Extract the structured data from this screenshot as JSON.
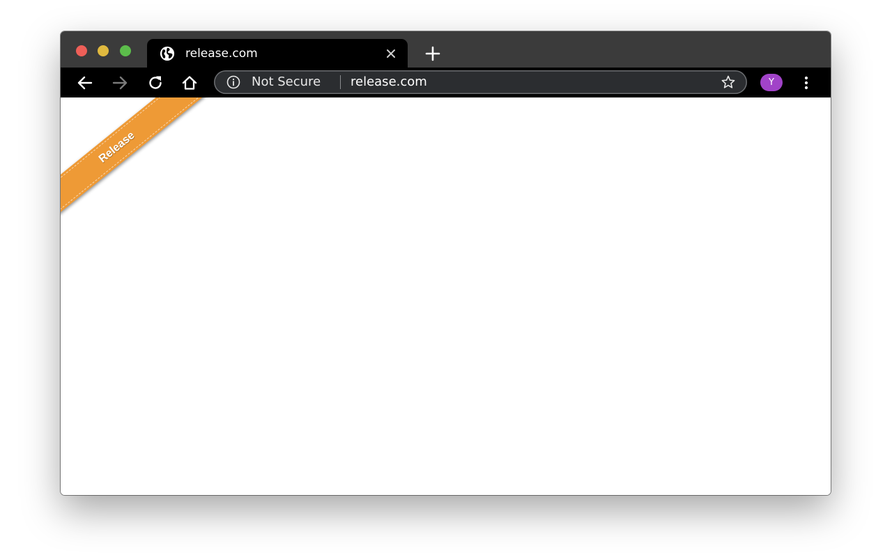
{
  "tab": {
    "title": "release.com",
    "favicon": "globe-icon"
  },
  "toolbar": {
    "security_label": "Not Secure",
    "url": "release.com",
    "profile_initial": "Y"
  },
  "page": {
    "ribbon_label": "Release"
  },
  "colors": {
    "titlebar": "#3b3b3b",
    "toolbar": "#000000",
    "avatar": "#a143c8",
    "ribbon": "#ee9a36",
    "close": "#ee5f58",
    "minimize": "#e0b93f",
    "zoom": "#5cbd4b"
  },
  "icons": {
    "back": "arrow-left-icon",
    "forward": "arrow-right-icon",
    "reload": "reload-icon",
    "home": "home-icon",
    "info": "info-icon",
    "bookmark": "star-icon",
    "menu": "kebab-menu-icon",
    "new_tab": "plus-icon",
    "tab_close": "close-icon"
  }
}
